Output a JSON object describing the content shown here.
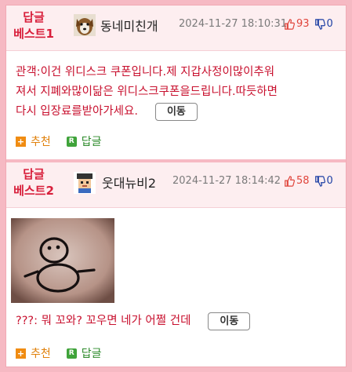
{
  "posts": [
    {
      "best_label_line1": "답글",
      "best_label_line2": "베스트1",
      "nickname": "동네미친개",
      "datetime": "2024-11-27 18:10:31",
      "upvotes": "93",
      "downvotes": "0",
      "body_lines": [
        "관객:이건 위디스크 쿠폰입니다.제 지갑사정이많이추워",
        "져서 지폐와많이닮은 위디스크쿠폰을드립니다.따듯하면",
        "다시 입장료를받아가세요."
      ],
      "move_label": "이동",
      "recommend_label": "추천",
      "reply_label": "답글"
    },
    {
      "best_label_line1": "답글",
      "best_label_line2": "베스트2",
      "nickname": "웃대뉴비2",
      "datetime": "2024-11-27 18:14:42",
      "upvotes": "58",
      "downvotes": "0",
      "body_lines": [
        "???: 뭐 꼬와? 꼬우면 네가 어쩔 건데"
      ],
      "move_label": "이동",
      "recommend_label": "추천",
      "reply_label": "답글"
    }
  ],
  "colors": {
    "accent_red": "#d81f3b",
    "text_red": "#c8102e",
    "up_red": "#e0453c",
    "down_blue": "#1d3fa4",
    "border_pink": "#f6b9c3",
    "header_bg": "#fdeef0"
  },
  "icons": [
    "thumbs-up-icon",
    "thumbs-down-icon",
    "plus-icon",
    "reply-r-icon"
  ]
}
